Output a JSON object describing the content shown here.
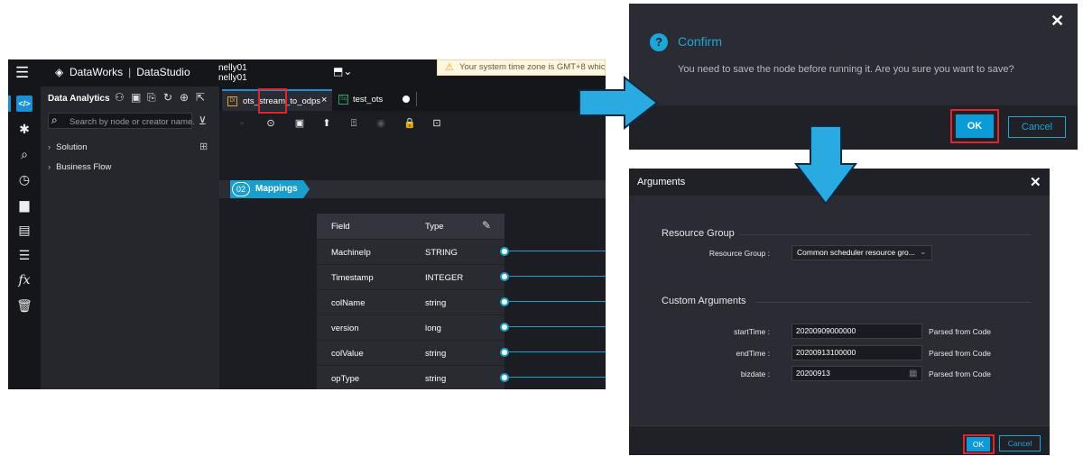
{
  "main": {
    "brand": "DataWorks",
    "brand_app": "DataStudio",
    "user_line1": "nelly01",
    "user_line2": "nelly01",
    "tz_banner": "Your system time zone is GMT+8 which",
    "sidebar": {
      "title": "Data Analytics",
      "search_placeholder": "Search by node or creator name.",
      "items": [
        {
          "label": "Solution"
        },
        {
          "label": "Business Flow"
        }
      ]
    },
    "tabs": [
      {
        "label": "ots_stream_to_odps",
        "type": "DI"
      },
      {
        "label": "test_ots",
        "type": "Sq"
      }
    ],
    "mappings": {
      "step": "02",
      "label": "Mappings",
      "columns": [
        "Field",
        "Type"
      ],
      "rows": [
        {
          "field": "MachineIp",
          "type": "STRING"
        },
        {
          "field": "Timestamp",
          "type": "INTEGER"
        },
        {
          "field": "colName",
          "type": "string"
        },
        {
          "field": "version",
          "type": "long"
        },
        {
          "field": "colValue",
          "type": "string"
        },
        {
          "field": "opType",
          "type": "string"
        }
      ]
    }
  },
  "confirm": {
    "title": "Confirm",
    "message": "You need to save the node before running it. Are you sure you want to save?",
    "ok": "OK",
    "cancel": "Cancel"
  },
  "arguments": {
    "title": "Arguments",
    "resource_section": "Resource Group",
    "resource_label": "Resource Group :",
    "resource_value": "Common scheduler resource gro...",
    "custom_section": "Custom Arguments",
    "params": [
      {
        "label": "startTime :",
        "value": "20200909000000",
        "note": "Parsed from Code"
      },
      {
        "label": "endTime :",
        "value": "20200913100000",
        "note": "Parsed from Code"
      },
      {
        "label": "bizdate :",
        "value": "20200913",
        "note": "Parsed from Code"
      }
    ],
    "ok": "OK",
    "cancel": "Cancel"
  },
  "colors": {
    "accent": "#1ba7d8",
    "highlight": "#e3252d",
    "arrow": "#29abe2"
  }
}
